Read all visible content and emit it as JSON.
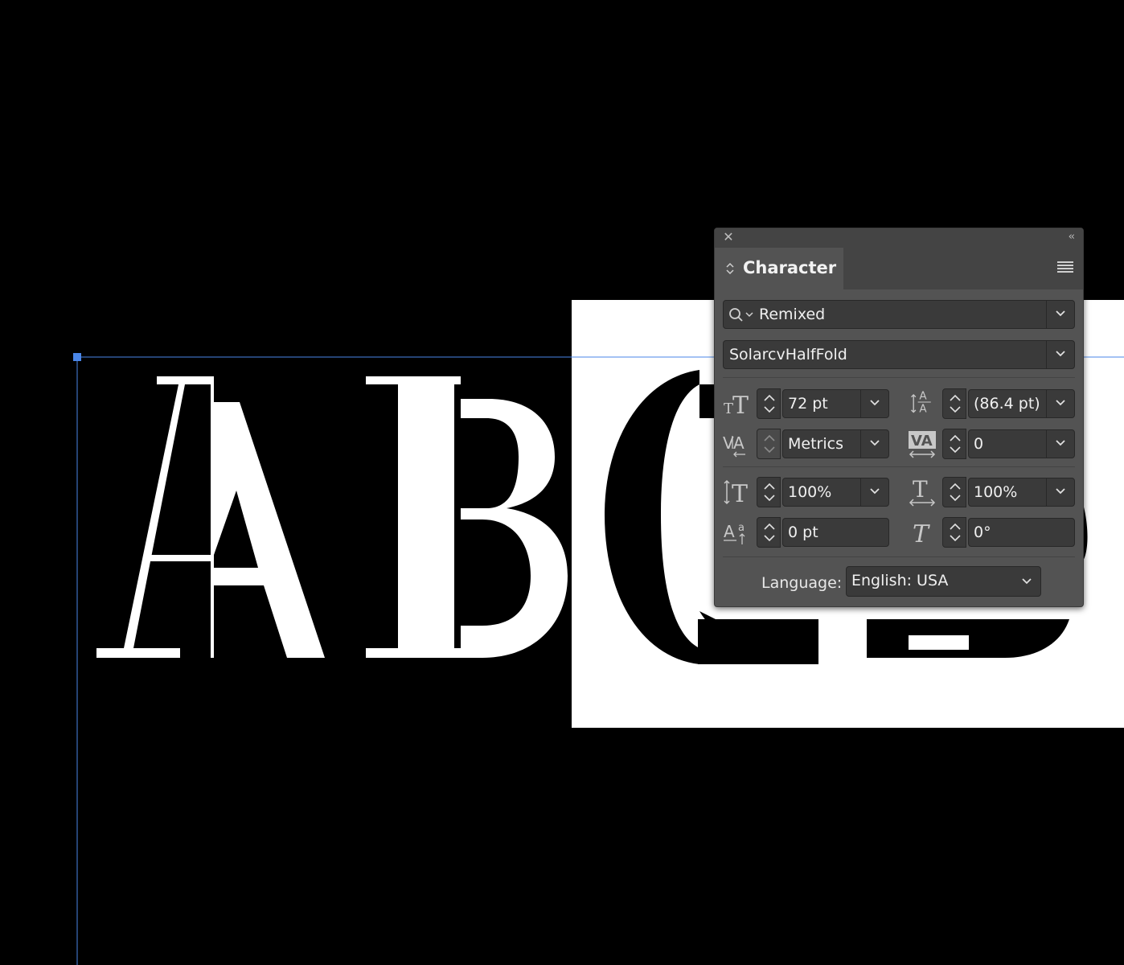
{
  "canvas": {
    "letters": [
      "A",
      "B",
      "C",
      "D"
    ],
    "background_color": "#000000",
    "text_color": "#ffffff",
    "guide_color": "#4a86e8"
  },
  "panel": {
    "title": "Character",
    "font_search": {
      "value": "Remixed",
      "icon": "search-icon"
    },
    "font_family": "SolarcvHalfFold",
    "font_size": "72 pt",
    "leading": "(86.4 pt)",
    "kerning": "Metrics",
    "tracking": "0",
    "vertical_scale": "100%",
    "horizontal_scale": "100%",
    "baseline_shift": "0 pt",
    "skew": "0°",
    "language_label": "Language:",
    "language": "English: USA",
    "icons": {
      "close": "close-icon",
      "collapse": "collapse-icon",
      "menu": "panel-menu-icon"
    }
  }
}
